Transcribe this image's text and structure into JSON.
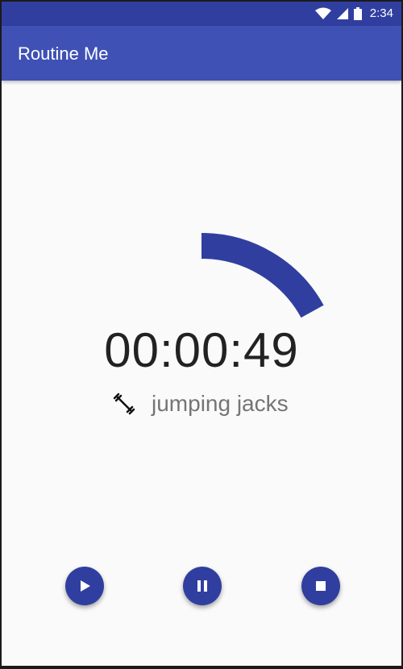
{
  "status_bar": {
    "time": "2:34"
  },
  "app_bar": {
    "title": "Routine Me"
  },
  "timer": {
    "display": "00:00:49",
    "progress": 0.17
  },
  "exercise": {
    "name": "jumping jacks",
    "icon": "dumbbell-icon"
  },
  "controls": {
    "play_icon": "play-icon",
    "pause_icon": "pause-icon",
    "stop_icon": "stop-icon"
  },
  "colors": {
    "primary": "#3f51b5",
    "primary_dark": "#303f9f",
    "arc": "#303f9f"
  }
}
